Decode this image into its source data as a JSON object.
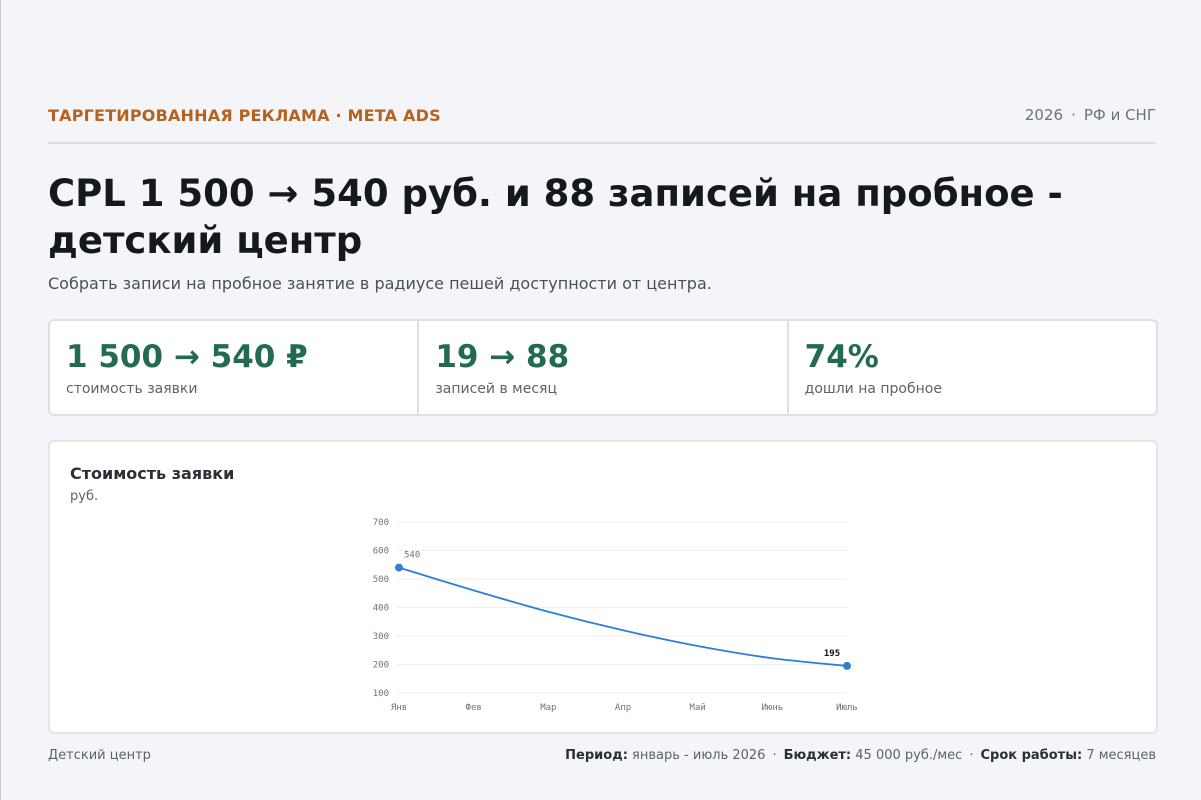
{
  "header": {
    "eyebrow": "ТАРГЕТИРОВАННАЯ РЕКЛАМА · META ADS",
    "year": "2026",
    "separator": "·",
    "region": "РФ и СНГ"
  },
  "title": "CPL 1 500 → 540 руб. и 88 записей на пробное - детский центр",
  "subtitle": "Собрать записи на пробное занятие в радиусе пешей доступности от центра.",
  "kpis": [
    {
      "value": "1 500 → 540 ₽",
      "label": "стоимость заявки"
    },
    {
      "value": "19 → 88",
      "label": "записей в месяц"
    },
    {
      "value": "74%",
      "label": "дошли на пробное"
    }
  ],
  "chart_card": {
    "title": "Стоимость заявки",
    "unit": "руб."
  },
  "chart_data": {
    "type": "line",
    "title": "Стоимость заявки",
    "ylabel": "руб.",
    "categories": [
      "Янв",
      "Фев",
      "Мар",
      "Апр",
      "Май",
      "Июнь",
      "Июль"
    ],
    "series": [
      {
        "values": [
          540,
          460,
          385,
          320,
          265,
          222,
          195
        ]
      }
    ],
    "ylim": [
      100,
      700
    ],
    "yticks": [
      100,
      200,
      300,
      400,
      500,
      600,
      700
    ],
    "annotations": [
      {
        "index": 0,
        "label": "540"
      },
      {
        "index": 6,
        "label": "195"
      }
    ],
    "grid": true,
    "color": "#2f7fd6"
  },
  "footer": {
    "left": "Детский центр",
    "period_label": "Период:",
    "period_value": "январь - июль 2026",
    "budget_label": "Бюджет:",
    "budget_value": "45 000 руб./мес",
    "term_label": "Срок работы:",
    "term_value": "7 месяцев",
    "separator": "·"
  }
}
